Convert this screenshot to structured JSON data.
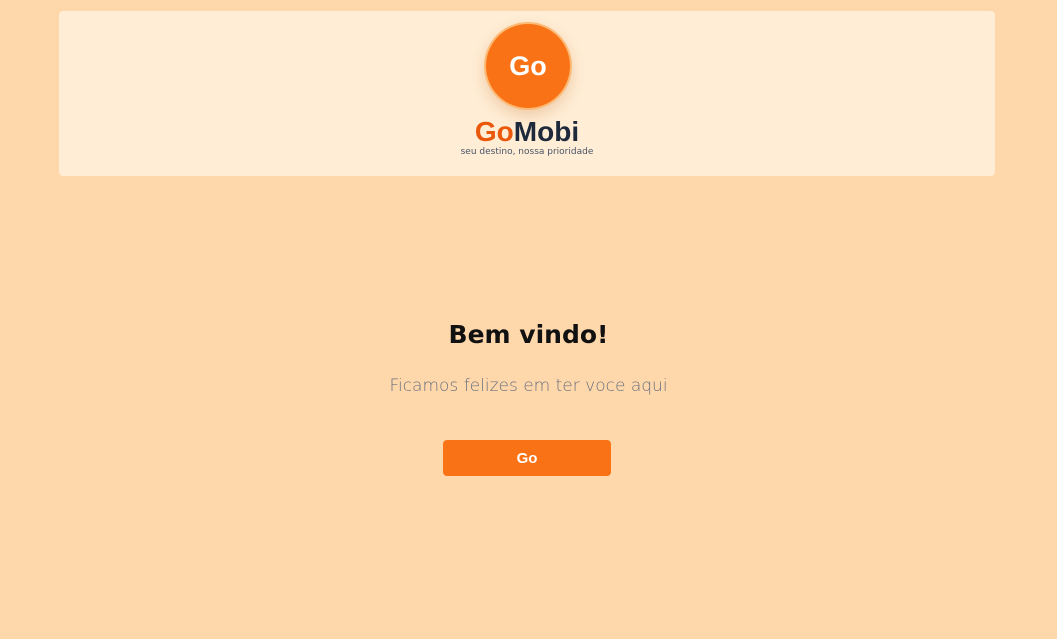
{
  "header": {
    "logo_text": "Go",
    "brand_part1": "Go",
    "brand_part2": "Mobi",
    "tagline": "seu destino, nossa prioridade"
  },
  "welcome": {
    "title": "Bem vindo!",
    "subtitle": "Ficamos felizes em ter voce aqui",
    "button_label": "Go"
  },
  "colors": {
    "page_background": "#fed7aa",
    "header_background": "#ffedd5",
    "accent": "#f97316",
    "brand_dark": "#1e293b"
  }
}
